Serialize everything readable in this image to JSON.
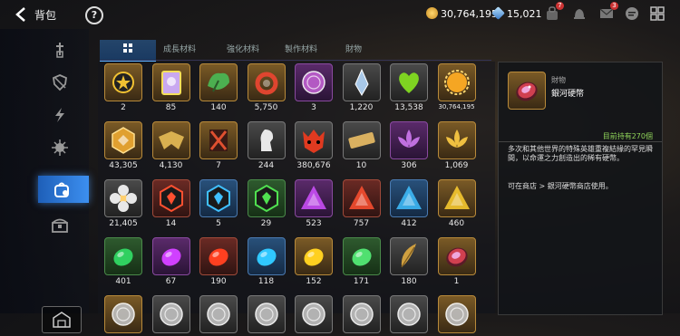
{
  "header": {
    "title": "背包",
    "help_label": "?",
    "gold": "30,764,195",
    "crystal": "15,021",
    "badges": [
      "7",
      "3"
    ]
  },
  "tabs": [
    {
      "label": "",
      "icon": "grid-icon",
      "active": true
    },
    {
      "label": "成長材料",
      "active": false
    },
    {
      "label": "強化材料",
      "active": false
    },
    {
      "label": "製作材料",
      "active": false
    },
    {
      "label": "財物",
      "active": false
    }
  ],
  "sidebar": [
    {
      "icon": "sword-shield-icon",
      "active": false
    },
    {
      "icon": "shield-icon",
      "active": false
    },
    {
      "icon": "lightning-icon",
      "active": false
    },
    {
      "icon": "gear-spike-icon",
      "active": false
    },
    {
      "icon": "bag-icon",
      "active": true
    },
    {
      "icon": "chest-icon",
      "active": false
    }
  ],
  "items": [
    {
      "qty": "2",
      "quality": "gold",
      "icon": "star-orb",
      "color": "#f1c232"
    },
    {
      "qty": "85",
      "quality": "gold",
      "icon": "card",
      "color": "#c9a8f0"
    },
    {
      "qty": "140",
      "quality": "gold",
      "icon": "leaf",
      "color": "#4caf50"
    },
    {
      "qty": "5,750",
      "quality": "gold",
      "icon": "ring",
      "color": "#e0452f"
    },
    {
      "qty": "3",
      "quality": "purple",
      "icon": "coin",
      "color": "#c060d0"
    },
    {
      "qty": "1,220",
      "quality": "gray",
      "icon": "crystal-shard",
      "color": "#a8c8e8"
    },
    {
      "qty": "13,538",
      "quality": "gray",
      "icon": "heart",
      "color": "#7ed321"
    },
    {
      "qty": "30,764,195",
      "quality": "gold",
      "icon": "sun-coin",
      "color": "#f5a623"
    },
    {
      "qty": "43,305",
      "quality": "gold",
      "icon": "hex-badge",
      "color": "#e0a030"
    },
    {
      "qty": "4,130",
      "quality": "gold",
      "icon": "eagle",
      "color": "#d9b050"
    },
    {
      "qty": "7",
      "quality": "gold",
      "icon": "flag",
      "color": "#e05030"
    },
    {
      "qty": "244",
      "quality": "gray",
      "icon": "knight",
      "color": "#e8e8e8"
    },
    {
      "qty": "380,676",
      "quality": "gray",
      "icon": "demon-mask",
      "color": "#e03a20"
    },
    {
      "qty": "10",
      "quality": "gray",
      "icon": "ticket",
      "color": "#d9b060"
    },
    {
      "qty": "306",
      "quality": "purple",
      "icon": "lotus",
      "color": "#c070e0"
    },
    {
      "qty": "1,069",
      "quality": "gold",
      "icon": "lotus",
      "color": "#f0c040"
    },
    {
      "qty": "21,405",
      "quality": "gray",
      "icon": "flower",
      "color": "#e8e8e8"
    },
    {
      "qty": "14",
      "quality": "red",
      "icon": "hex-rune",
      "color": "#ff5030"
    },
    {
      "qty": "5",
      "quality": "blue",
      "icon": "hex-rune",
      "color": "#40c0ff"
    },
    {
      "qty": "29",
      "quality": "green",
      "icon": "hex-rune",
      "color": "#50e050"
    },
    {
      "qty": "523",
      "quality": "purple",
      "icon": "tri-rune",
      "color": "#d050ff"
    },
    {
      "qty": "757",
      "quality": "red",
      "icon": "tri-rune",
      "color": "#ff5030"
    },
    {
      "qty": "412",
      "quality": "blue",
      "icon": "tri-rune",
      "color": "#40c0ff"
    },
    {
      "qty": "460",
      "quality": "gold",
      "icon": "tri-rune",
      "color": "#ffd030"
    },
    {
      "qty": "401",
      "quality": "green",
      "icon": "gem",
      "color": "#30d060"
    },
    {
      "qty": "67",
      "quality": "purple",
      "icon": "gem",
      "color": "#d040ff"
    },
    {
      "qty": "190",
      "quality": "red",
      "icon": "gem",
      "color": "#ff4020"
    },
    {
      "qty": "118",
      "quality": "blue",
      "icon": "gem",
      "color": "#30c8ff"
    },
    {
      "qty": "152",
      "quality": "gold",
      "icon": "gem",
      "color": "#ffd020"
    },
    {
      "qty": "171",
      "quality": "green",
      "icon": "gem",
      "color": "#50e070"
    },
    {
      "qty": "180",
      "quality": "gray",
      "icon": "feather",
      "color": "#d0a040"
    },
    {
      "qty": "1",
      "quality": "gold",
      "icon": "galaxy-coin",
      "color": "#d04050"
    },
    {
      "qty": "",
      "quality": "gold",
      "icon": "coin",
      "color": "#c0c0c0"
    },
    {
      "qty": "",
      "quality": "gray",
      "icon": "coin",
      "color": "#c0c0c0"
    },
    {
      "qty": "",
      "quality": "gray",
      "icon": "coin",
      "color": "#c0c0c0"
    },
    {
      "qty": "",
      "quality": "gray",
      "icon": "coin",
      "color": "#c0c0c0"
    },
    {
      "qty": "",
      "quality": "gray",
      "icon": "coin",
      "color": "#c0c0c0"
    },
    {
      "qty": "",
      "quality": "gray",
      "icon": "coin",
      "color": "#c0c0c0"
    },
    {
      "qty": "",
      "quality": "gray",
      "icon": "coin",
      "color": "#c0c0c0"
    },
    {
      "qty": "",
      "quality": "gold",
      "icon": "coin",
      "color": "#c0c0c0"
    }
  ],
  "detail": {
    "category": "財物",
    "name": "銀河硬幣",
    "owned": "目前持有270個",
    "description": "多次和其他世界的特殊英雄重複結緣的罕見瞬間，以命運之力創造出的稀有硬幣。",
    "source": "可在商店 > 銀河硬幣商店使用。"
  }
}
